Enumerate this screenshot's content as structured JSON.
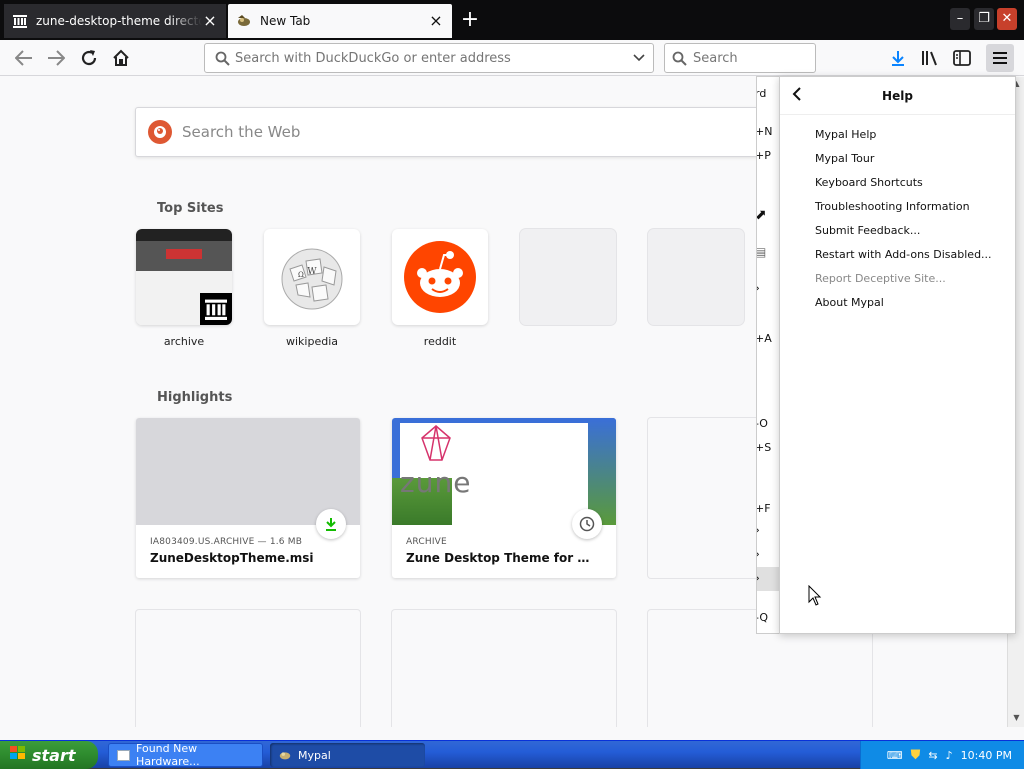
{
  "tabs": [
    {
      "title": "zune-desktop-theme directory listing",
      "icon": "archive-icon"
    },
    {
      "title": "New Tab",
      "icon": "mypal-icon"
    }
  ],
  "new_tab_symbol": "+",
  "window_controls": {
    "minimize": "–",
    "maximize": "❐",
    "close": "✕"
  },
  "nav": {
    "url_placeholder": "Search with DuckDuckGo or enter address",
    "search_placeholder": "Search"
  },
  "newtab_page": {
    "search_placeholder": "Search the Web",
    "top_sites_heading": "Top Sites",
    "top_sites": [
      {
        "label": "archive"
      },
      {
        "label": "wikipedia"
      },
      {
        "label": "reddit"
      },
      {
        "label": ""
      },
      {
        "label": ""
      }
    ],
    "highlights_heading": "Highlights",
    "highlights": [
      {
        "meta": "IA803409.US.ARCHIVE — 1.6 MB",
        "name": "ZuneDesktopTheme.msi",
        "badge": "download-icon"
      },
      {
        "meta": "ARCHIVE",
        "name": "Zune Desktop Theme for Windo...",
        "badge": "clock-icon",
        "image_text": "zune"
      }
    ]
  },
  "main_menu_partial": [
    "rd",
    "+N",
    "+P",
    "+A",
    "-O",
    "+S",
    "+F",
    "-Q"
  ],
  "help_panel": {
    "title": "Help",
    "items": [
      {
        "label": "Mypal Help",
        "disabled": false
      },
      {
        "label": "Mypal Tour",
        "disabled": false
      },
      {
        "label": "Keyboard Shortcuts",
        "disabled": false
      },
      {
        "label": "Troubleshooting Information",
        "disabled": false
      },
      {
        "label": "Submit Feedback...",
        "disabled": false
      },
      {
        "label": "Restart with Add-ons Disabled...",
        "disabled": false
      },
      {
        "label": "Report Deceptive Site...",
        "disabled": true
      },
      {
        "label": "About Mypal",
        "disabled": false
      }
    ]
  },
  "taskbar": {
    "start_label": "start",
    "buttons": [
      {
        "label": "Found New Hardware..."
      },
      {
        "label": "Mypal"
      }
    ],
    "clock": "10:40 PM"
  },
  "colors": {
    "accent": "#0a84ff",
    "reddit": "#ff4500",
    "duckduckgo": "#de5833",
    "download": "#12bc00"
  }
}
